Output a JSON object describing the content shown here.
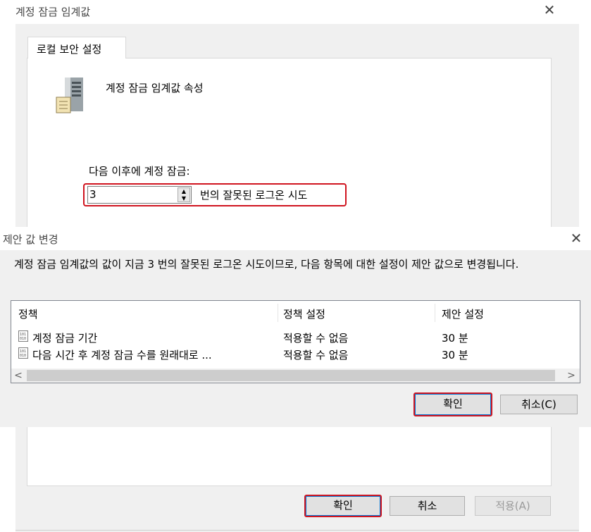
{
  "bg_dialog": {
    "title": "계정 잠금 임계값",
    "tab_label": "로컬 보안 설정",
    "heading": "계정 잠금 임계값 속성",
    "field_label": "다음 이후에 계정 잠금:",
    "input_value": "3",
    "input_suffix": "번의 잘못된 로그온 시도",
    "ok_label": "확인",
    "cancel_label": "취소",
    "apply_label": "적용(A)"
  },
  "suggest_dialog": {
    "title": "제안 값 변경",
    "message": "계정 잠금 임계값의 값이 지금 3 번의 잘못된 로그온 시도이므로, 다음 항목에 대한 설정이 제안 값으로 변경됩니다.",
    "columns": [
      "정책",
      "정책 설정",
      "제안 설정"
    ],
    "rows": [
      {
        "policy": "계정 잠금 기간",
        "setting": "적용할 수 없음",
        "suggested": "30 분"
      },
      {
        "policy": "다음 시간 후 계정 잠금 수를 원래대로 ...",
        "setting": "적용할 수 없음",
        "suggested": "30 분"
      }
    ],
    "ok_label": "확인",
    "cancel_label": "취소(C)"
  },
  "icons": {
    "close": "close-icon",
    "server": "server-policy-icon",
    "policy": "policy-item-icon"
  },
  "colors": {
    "highlight": "#d0141f",
    "focus_blue": "#0078d7"
  }
}
